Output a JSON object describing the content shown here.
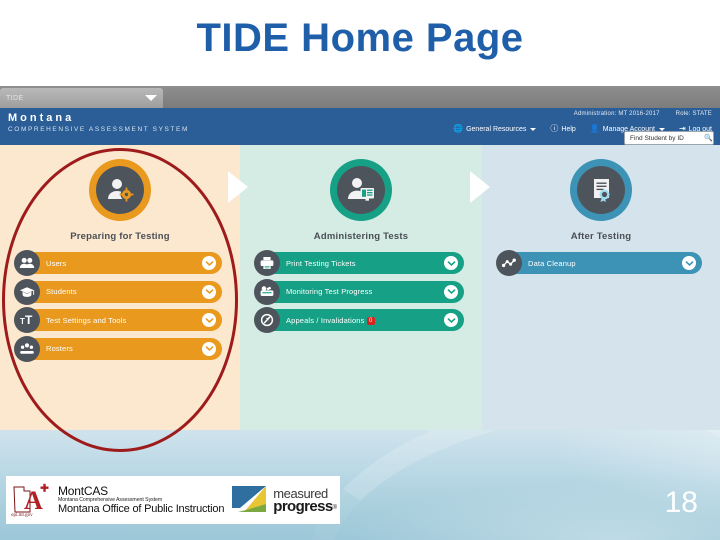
{
  "slide": {
    "title": "TIDE Home Page",
    "page_number": "18",
    "title_color": "#1f5fa9",
    "annotation": {
      "shape": "ellipse",
      "color": "#9e1b1b",
      "target": "Preparing for Testing column"
    }
  },
  "browser": {
    "tab_label": "TIDE",
    "tab_caret_icon": "chevron-down-icon"
  },
  "site_header": {
    "brand_name": "Montana",
    "brand_sub": "COMPREHENSIVE ASSESSMENT SYSTEM",
    "administration": "Administration: MT 2016-2017",
    "role": "Role: STATE",
    "nav": [
      {
        "label": "General Resources",
        "icon": "globe-icon",
        "has_caret": true
      },
      {
        "label": "Help",
        "icon": "help-circle-icon",
        "has_caret": false
      },
      {
        "label": "Manage Account",
        "icon": "user-icon",
        "has_caret": true
      },
      {
        "label": "Log out",
        "icon": "logout-icon",
        "has_caret": false
      }
    ]
  },
  "search": {
    "placeholder": "Find Student by ID",
    "value": "Find Student by ID",
    "icon": "search-icon"
  },
  "columns": [
    {
      "id": "preparing",
      "title": "Preparing for Testing",
      "accent": "#e8991e",
      "bg": "#fbe8cf",
      "header_icon": "user-gear-icon",
      "tasks": [
        {
          "label": "Users",
          "icon": "users-icon",
          "badge": null
        },
        {
          "label": "Students",
          "icon": "graduation-cap-icon",
          "badge": null
        },
        {
          "label": "Test Settings and Tools",
          "icon": "text-size-icon",
          "badge": null
        },
        {
          "label": "Rosters",
          "icon": "roster-group-icon",
          "badge": null
        }
      ]
    },
    {
      "id": "administering",
      "title": "Administering Tests",
      "accent": "#16a085",
      "bg": "#d5ece4",
      "header_icon": "user-monitor-icon",
      "tasks": [
        {
          "label": "Print Testing Tickets",
          "icon": "printer-icon",
          "badge": null
        },
        {
          "label": "Monitoring Test Progress",
          "icon": "monitor-progress-icon",
          "badge": null
        },
        {
          "label": "Appeals / Invalidations",
          "icon": "appeal-icon",
          "badge": "0"
        }
      ]
    },
    {
      "id": "after",
      "title": "After Testing",
      "accent": "#3d93b5",
      "bg": "#d5e4ec",
      "header_icon": "certificate-icon",
      "tasks": [
        {
          "label": "Data Cleanup",
          "icon": "data-nodes-icon",
          "badge": null
        }
      ]
    }
  ],
  "footer_logos": {
    "montcas": {
      "title": "MontCAS",
      "subtitle": "Montana Comprehensive Assessment System",
      "agency": "Montana Office of Public Instruction",
      "url": "opi.mt.gov"
    },
    "measured_progress": {
      "line1": "measured",
      "line2": "progress",
      "registered_mark": "®"
    }
  }
}
